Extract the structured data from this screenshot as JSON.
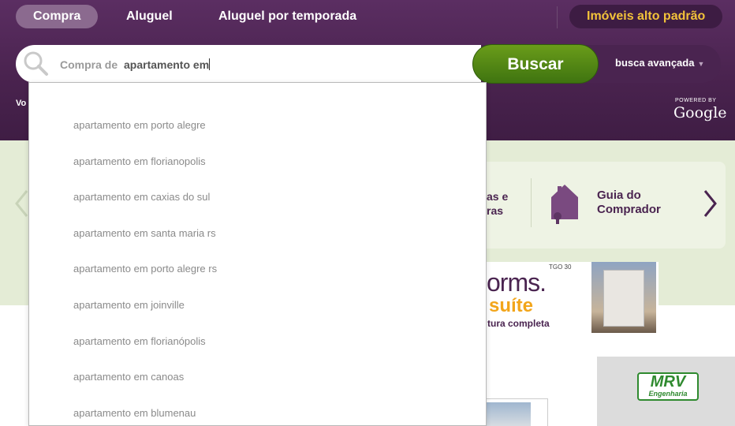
{
  "tabs": [
    {
      "label": "Compra",
      "active": true
    },
    {
      "label": "Aluguel",
      "active": false
    },
    {
      "label": "Aluguel por temporada",
      "active": false
    }
  ],
  "premium_tab": {
    "label": "Imóveis alto padrão"
  },
  "search": {
    "prefix": "Compra de",
    "query": "apartamento em",
    "button_label": "Buscar",
    "advanced_label": "busca avançada"
  },
  "header_fragment": "Vo",
  "powered_by": {
    "line1": "POWERED BY",
    "brand": "Google"
  },
  "carousel": {
    "card1_line1": "as e",
    "card1_line2": "ras",
    "card2_line1": "Guia do",
    "card2_line2": "Comprador"
  },
  "ad": {
    "forms_text": "orms.",
    "suite_text": "suíte",
    "estrutura_text": "tura completa",
    "logos_text": "TGO 30"
  },
  "mrv": {
    "brand": "MRV",
    "sub": "Engenharia"
  },
  "suggestions": [
    "apartamento em porto alegre",
    "apartamento em florianopolis",
    "apartamento em caxias do sul",
    "apartamento em santa maria rs",
    "apartamento em porto alegre rs",
    "apartamento em joinville",
    "apartamento em florianópolis",
    "apartamento em canoas",
    "apartamento em blumenau"
  ],
  "colors": {
    "header_bg": "#4a234f",
    "active_tab": "#8b6a8f",
    "premium_text": "#f2c23a",
    "search_button": "#4f8a14",
    "content_band": "#e4ecd6"
  }
}
